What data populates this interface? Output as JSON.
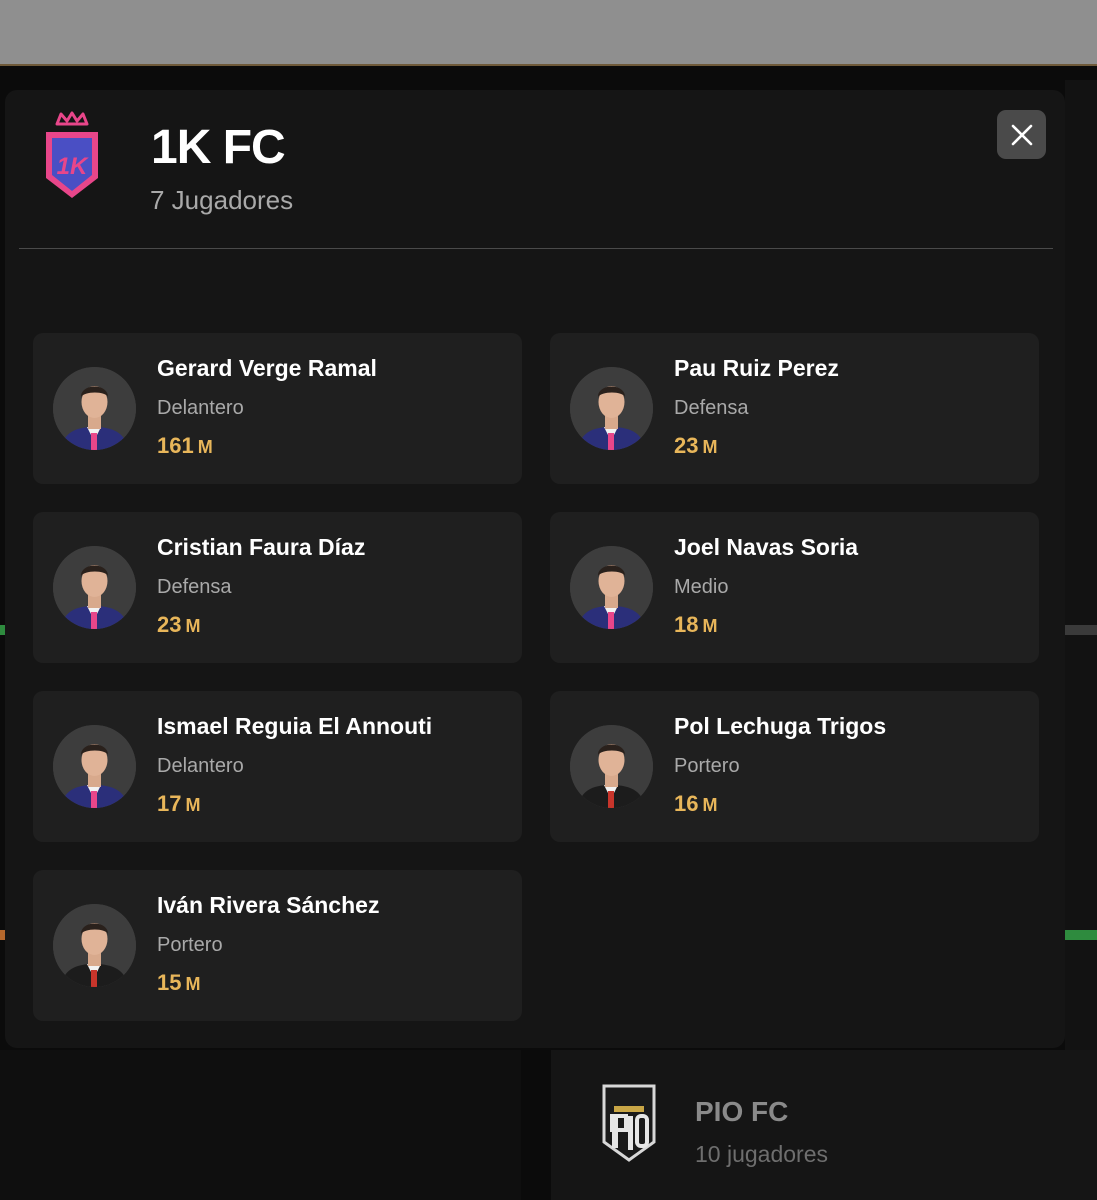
{
  "modal": {
    "team_name": "1K FC",
    "player_count": "7 Jugadores",
    "crest_text": "1K",
    "close_icon": "close-icon"
  },
  "players": [
    {
      "name": "Gerard Verge Ramal",
      "position": "Delantero",
      "value": "161",
      "unit": "M",
      "kit": "home"
    },
    {
      "name": "Pau Ruiz Perez",
      "position": "Defensa",
      "value": "23",
      "unit": "M",
      "kit": "home"
    },
    {
      "name": "Cristian Faura Díaz",
      "position": "Defensa",
      "value": "23",
      "unit": "M",
      "kit": "home"
    },
    {
      "name": "Joel Navas Soria",
      "position": "Medio",
      "value": "18",
      "unit": "M",
      "kit": "home"
    },
    {
      "name": "Ismael Reguia El Annouti",
      "position": "Delantero",
      "value": "17",
      "unit": "M",
      "kit": "home"
    },
    {
      "name": "Pol Lechuga Trigos",
      "position": "Portero",
      "value": "16",
      "unit": "M",
      "kit": "keeper"
    },
    {
      "name": "Iván Rivera Sánchez",
      "position": "Portero",
      "value": "15",
      "unit": "M",
      "kit": "keeper"
    }
  ],
  "background": {
    "next_team_name": "PIO FC",
    "next_team_count": "10 jugadores"
  },
  "colors": {
    "value": "#e8b65a",
    "crest_pink": "#e8468a",
    "crest_blue": "#4a4fc4"
  }
}
